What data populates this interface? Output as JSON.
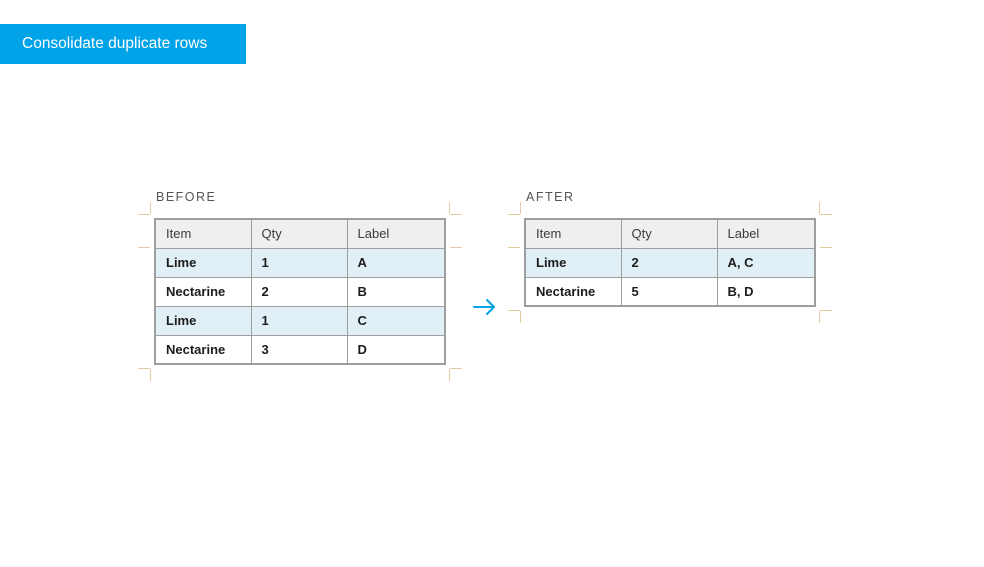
{
  "title": "Consolidate duplicate rows",
  "before": {
    "caption": "BEFORE",
    "headers": [
      "Item",
      "Qty",
      "Label"
    ],
    "rows": [
      {
        "cells": [
          "Lime",
          "1",
          "A"
        ],
        "highlight": true
      },
      {
        "cells": [
          "Nectarine",
          "2",
          "B"
        ],
        "highlight": false
      },
      {
        "cells": [
          "Lime",
          "1",
          "C"
        ],
        "highlight": true
      },
      {
        "cells": [
          "Nectarine",
          "3",
          "D"
        ],
        "highlight": false
      }
    ]
  },
  "after": {
    "caption": "AFTER",
    "headers": [
      "Item",
      "Qty",
      "Label"
    ],
    "rows": [
      {
        "cells": [
          "Lime",
          "2",
          "A, C"
        ],
        "highlight": true
      },
      {
        "cells": [
          "Nectarine",
          "5",
          "B, D"
        ],
        "highlight": false
      }
    ]
  }
}
